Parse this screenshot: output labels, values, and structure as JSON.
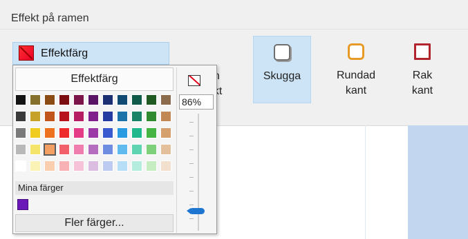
{
  "ribbon": {
    "group_title": "Effekt på ramen",
    "effect_button": {
      "label": "Effektfärg",
      "color": "#e8002a"
    },
    "partial_button": {
      "line1": "en",
      "line2": "ekt"
    },
    "buttons": [
      {
        "id": "skugga",
        "line1": "Skugga",
        "line2": "",
        "icon": "shadow-square-icon",
        "selected": true
      },
      {
        "id": "rundad",
        "line1": "Rundad",
        "line2": "kant",
        "icon": "rounded-square-icon",
        "color": "#e89a28"
      },
      {
        "id": "rak",
        "line1": "Rak",
        "line2": "kant",
        "icon": "straight-square-icon",
        "color": "#b0262c"
      }
    ]
  },
  "popup": {
    "header": "Effektfärg",
    "no_color_icon": "no-color-icon",
    "opacity_value": "86%",
    "my_colors_label": "Mina färger",
    "my_colors": [
      "#6b18b8"
    ],
    "more_colors_label": "Fler färger...",
    "palette": [
      [
        "#141414",
        "#86702e",
        "#8a4c14",
        "#7c0e12",
        "#7b1449",
        "#5a1466",
        "#1c2f73",
        "#114b73",
        "#0f5a48",
        "#1f5a22",
        "#8c6b4c"
      ],
      [
        "#3a3a3a",
        "#c7a22a",
        "#c1561c",
        "#b7131c",
        "#b51e63",
        "#7f208c",
        "#243ba2",
        "#1a72a8",
        "#178266",
        "#2f8a30",
        "#c18856"
      ],
      [
        "#7a7a7a",
        "#f1cc20",
        "#ee7120",
        "#ee2a2a",
        "#e43c86",
        "#9c3aa8",
        "#3a5bd0",
        "#2a9be0",
        "#21b88e",
        "#45b442",
        "#d6a06e"
      ],
      [
        "#b8b8b8",
        "#f5e46a",
        "#f4a064",
        "#f2616a",
        "#ef7eae",
        "#b56dbf",
        "#6f8de0",
        "#61baed",
        "#5ed4b0",
        "#7fd07a",
        "#e4bf9c"
      ],
      [
        "#ffffff",
        "#fbf2b6",
        "#f9cfb0",
        "#f8b2b6",
        "#f6c2d8",
        "#dcbde2",
        "#bccbef",
        "#b6def6",
        "#b4ecdd",
        "#c6edc2",
        "#f2dfcd"
      ]
    ],
    "selected_cell": [
      3,
      2
    ]
  }
}
